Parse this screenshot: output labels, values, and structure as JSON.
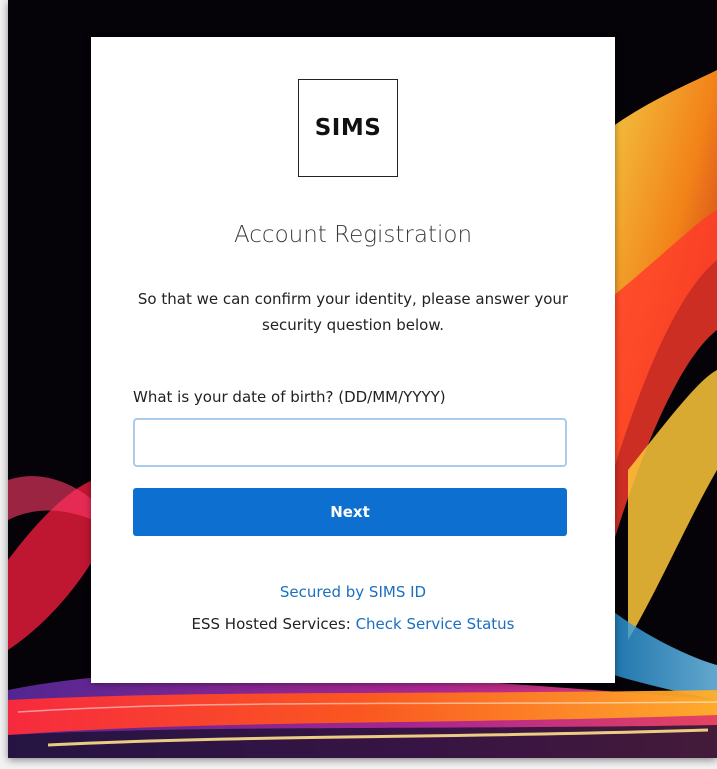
{
  "logo": {
    "text": "SIMS"
  },
  "form": {
    "title": "Account Registration",
    "description": "So that we can confirm your identity, please answer your security question below.",
    "question_label": "What is your date of birth? (DD/MM/YYYY)",
    "answer_value": "",
    "answer_placeholder": "",
    "next_label": "Next"
  },
  "footer": {
    "secured_text": "Secured by SIMS ID",
    "ess_prefix": "ESS Hosted Services:",
    "status_link": "Check Service Status"
  },
  "colors": {
    "primary_button": "#0d6fd0",
    "link": "#1a6fc1",
    "input_border": "#aacbec"
  }
}
